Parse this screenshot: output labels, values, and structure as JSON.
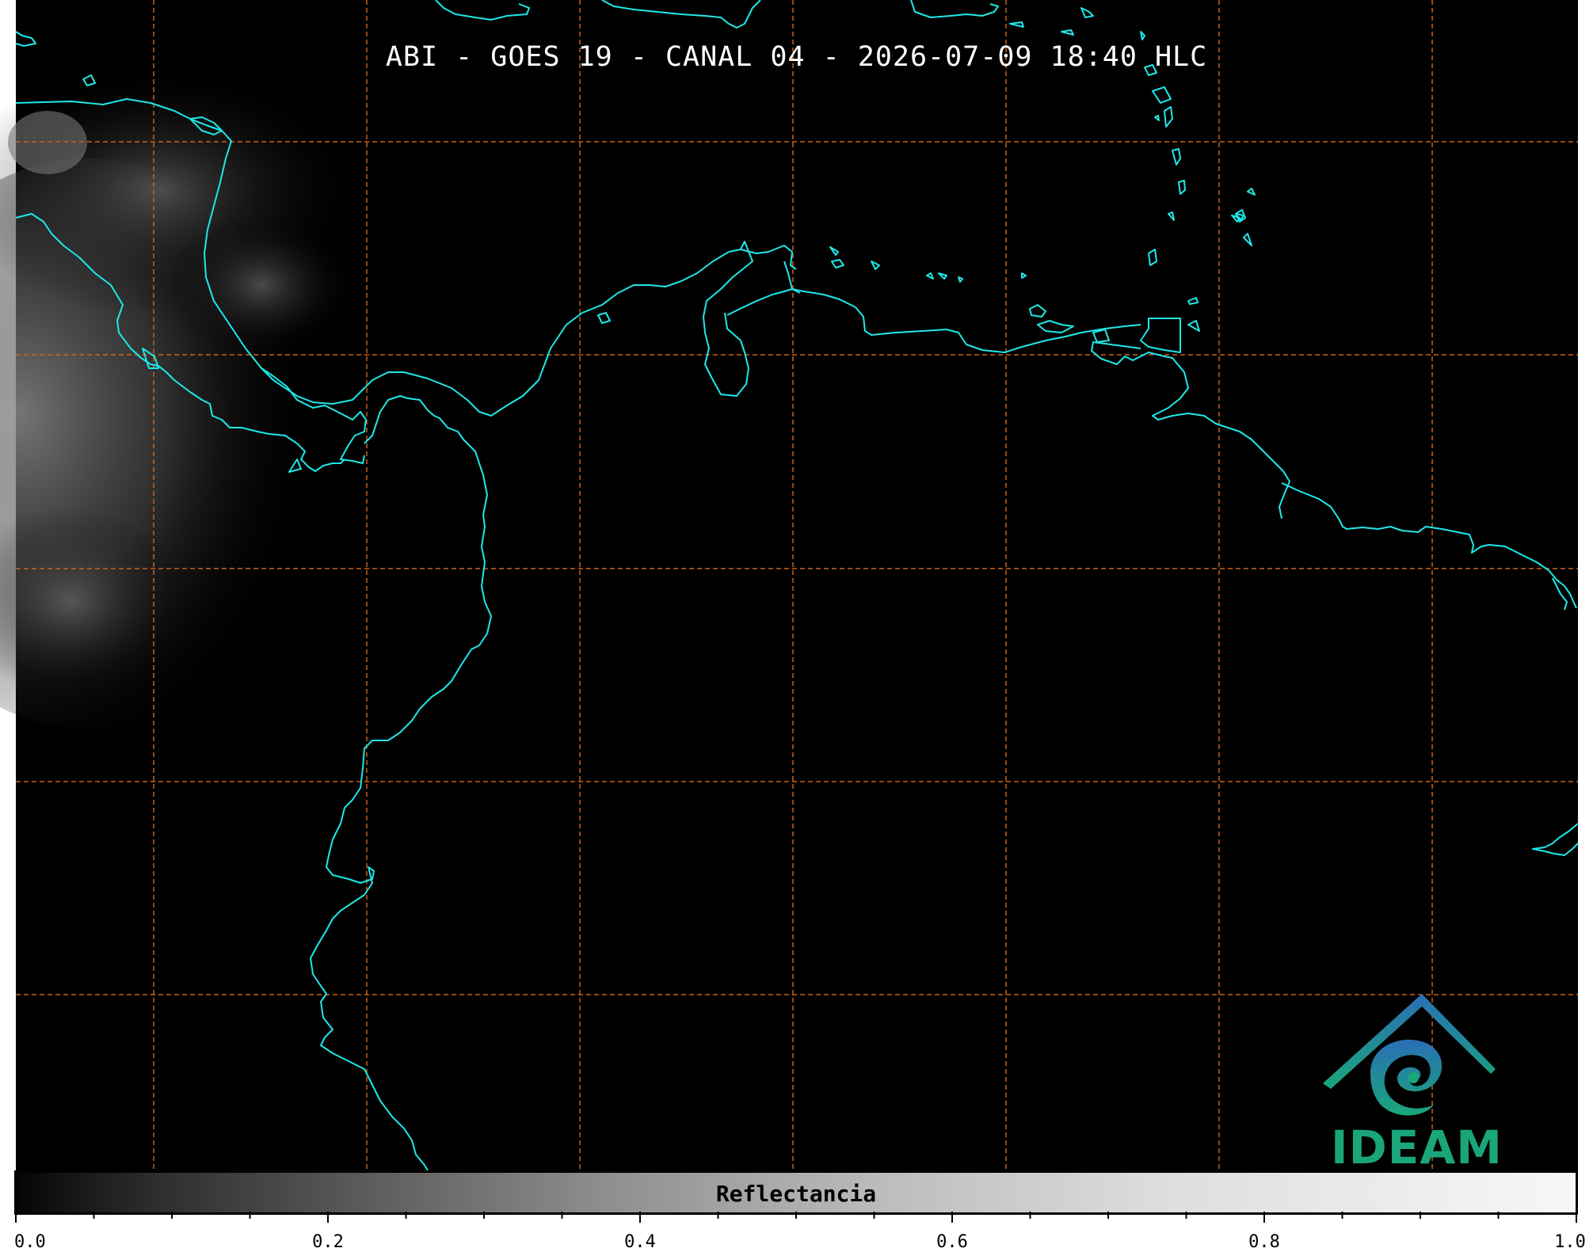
{
  "map": {
    "title": "ABI - GOES 19 - CANAL 04 - 2026-07-09 18:40 HLC",
    "background_color": "#000000",
    "coastline_color": "#1ee8e8",
    "grid_color": "#c8641e"
  },
  "logo": {
    "text": "IDEAM",
    "colors": {
      "top": "#2a6fb5",
      "bottom": "#1aa67a"
    }
  },
  "colorbar": {
    "label": "Reflectancia",
    "min": 0.0,
    "max": 1.0,
    "tick_labels": [
      "0.0",
      "0.2",
      "0.4",
      "0.6",
      "0.8",
      "1.0"
    ],
    "colormap": "grayscale"
  }
}
